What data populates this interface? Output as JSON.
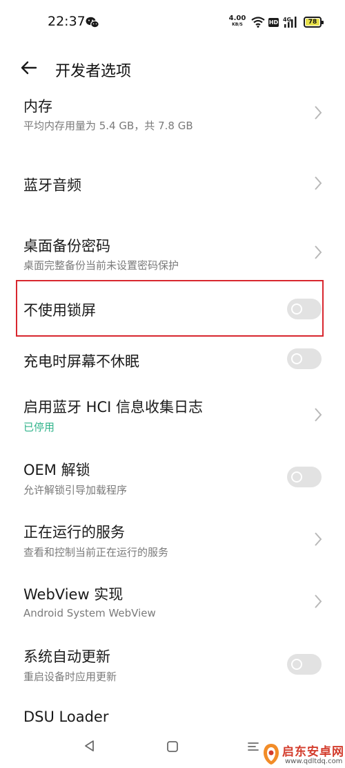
{
  "status_bar": {
    "time": "22:37",
    "net_speed_value": "4.00",
    "net_speed_unit": "KB/S",
    "hd_label": "HD",
    "network_label": "4G",
    "battery_level": "78",
    "icons": [
      "wechat-icon",
      "wifi-icon",
      "hd-icon",
      "signal-icon",
      "battery-icon"
    ]
  },
  "header": {
    "title": "开发者选项",
    "back_icon": "arrow-left-icon"
  },
  "settings": {
    "memory": {
      "title": "内存",
      "subtitle": "平均内存用量为 5.4 GB，共 7.8 GB"
    },
    "bluetooth_audio": {
      "title": "蓝牙音频"
    },
    "desktop_backup_password": {
      "title": "桌面备份密码",
      "subtitle": "桌面完整备份当前未设置密码保护"
    },
    "no_lock_screen": {
      "title": "不使用锁屏",
      "toggle": "off"
    },
    "stay_awake": {
      "title": "充电时屏幕不休眠",
      "toggle": "off"
    },
    "bt_hci_log": {
      "title": "启用蓝牙 HCI 信息收集日志",
      "status": "已停用"
    },
    "oem_unlock": {
      "title": "OEM 解锁",
      "subtitle": "允许解锁引导加载程序",
      "toggle": "off"
    },
    "running_services": {
      "title": "正在运行的服务",
      "subtitle": "查看和控制当前正在运行的服务"
    },
    "webview": {
      "title": "WebView 实现",
      "subtitle": "Android System WebView"
    },
    "auto_update": {
      "title": "系统自动更新",
      "subtitle": "重启设备时应用更新",
      "toggle": "off"
    },
    "dsu_loader": {
      "title": "DSU Loader"
    }
  },
  "nav_bar": {
    "icons": [
      "triangle-back-icon",
      "square-home-icon",
      "menu-recents-icon"
    ]
  },
  "watermark": {
    "name": "启东安卓网",
    "url": "www.qdltdq.com"
  },
  "colors": {
    "highlight": "#d8262e",
    "status_green": "#2fb38a",
    "toggle_off": "#e2e2e2",
    "battery": "#e8e14a",
    "watermark_red": "#d33c2c"
  }
}
